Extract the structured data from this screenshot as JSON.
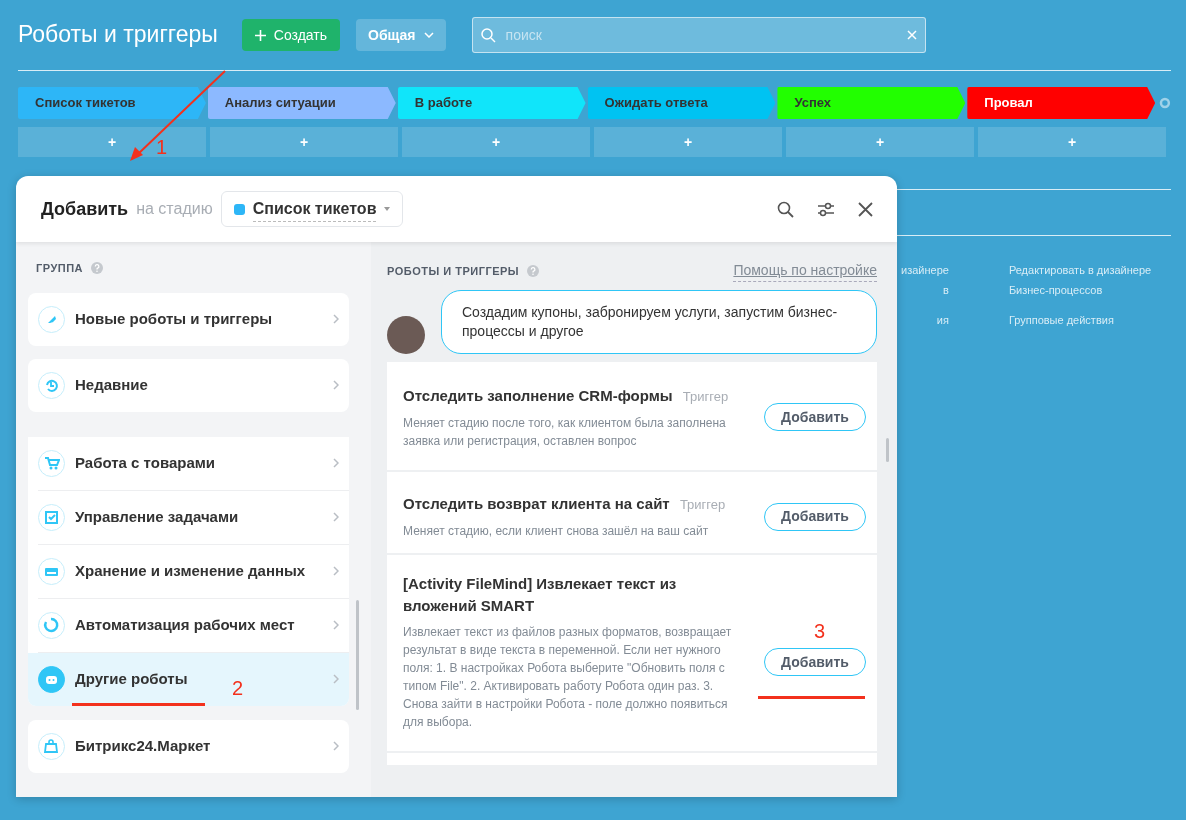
{
  "page": {
    "title": "Роботы и триггеры",
    "create_button": "Создать",
    "filter_button": "Общая",
    "search": {
      "placeholder": "поиск"
    }
  },
  "stages": [
    {
      "name": "Список тикетов",
      "color": "#2db6f7",
      "add": "+"
    },
    {
      "name": "Анализ ситуации",
      "color": "#8cb9ff",
      "add": "+"
    },
    {
      "name": "В работе",
      "color": "#10e5fa",
      "add": "+"
    },
    {
      "name": "Ожидать ответа",
      "color": "#00c3f2",
      "add": "+"
    },
    {
      "name": "Успех",
      "color": "#22ff00",
      "add": "+"
    },
    {
      "name": "Провал",
      "color": "#ff0000",
      "add": "+"
    }
  ],
  "background_links": {
    "column_1": [
      "изайнере",
      "в",
      "ия"
    ],
    "column_2": [
      "Редактировать в дизайнере Бизнес-процессов",
      "Групповые действия"
    ]
  },
  "dialog": {
    "title": "Добавить",
    "stage_label": "на стадию",
    "stage_select": {
      "value": "Список тикетов",
      "color": "#2db6f7"
    },
    "group_heading": "ГРУППА",
    "groups": [
      {
        "label": "Новые роботы и триггеры",
        "kind": "card",
        "selected": false
      },
      {
        "label": "Недавние",
        "kind": "card",
        "selected": false
      },
      {
        "label": "Работа с товарами",
        "kind": "row",
        "selected": false
      },
      {
        "label": "Управление задачами",
        "kind": "row",
        "selected": false
      },
      {
        "label": "Хранение и изменение данных",
        "kind": "row",
        "selected": false
      },
      {
        "label": "Автоматизация рабочих мест",
        "kind": "row",
        "selected": false
      },
      {
        "label": "Другие роботы",
        "kind": "row",
        "selected": true
      },
      {
        "label": "Битрикс24.Маркет",
        "kind": "card",
        "selected": false
      }
    ],
    "list_heading": "РОБОТЫ И ТРИГГЕРЫ",
    "help_link": "Помощь по настройке",
    "tip": "Создадим купоны, забронируем услуги, запустим бизнес-процессы и другое",
    "robots": [
      {
        "title": "Отследить заполнение CRM-формы",
        "tag": "Триггер",
        "description": "Меняет стадию после того, как клиентом была заполнена заявка или регистрация, оставлен вопрос",
        "button": "Добавить"
      },
      {
        "title": "Отследить возврат клиента на сайт",
        "tag": "Триггер",
        "description": "Меняет стадию, если клиент снова зашёл на ваш сайт",
        "button": "Добавить"
      },
      {
        "title": "[Activity FileMind] Извлекает текст из вложений SMART",
        "description": "Извлекает текст из файлов разных форматов, возвращает результат в виде текста в переменной. Если нет нужного поля: 1. В настройках Робота выберите \"Обновить поля с типом File\". 2. Активировать работу Робота один раз. 3. Снова зайти в настройки Робота - поле должно появиться для выбора.",
        "button": "Добавить"
      }
    ]
  },
  "annotations": [
    "1",
    "2",
    "3"
  ]
}
